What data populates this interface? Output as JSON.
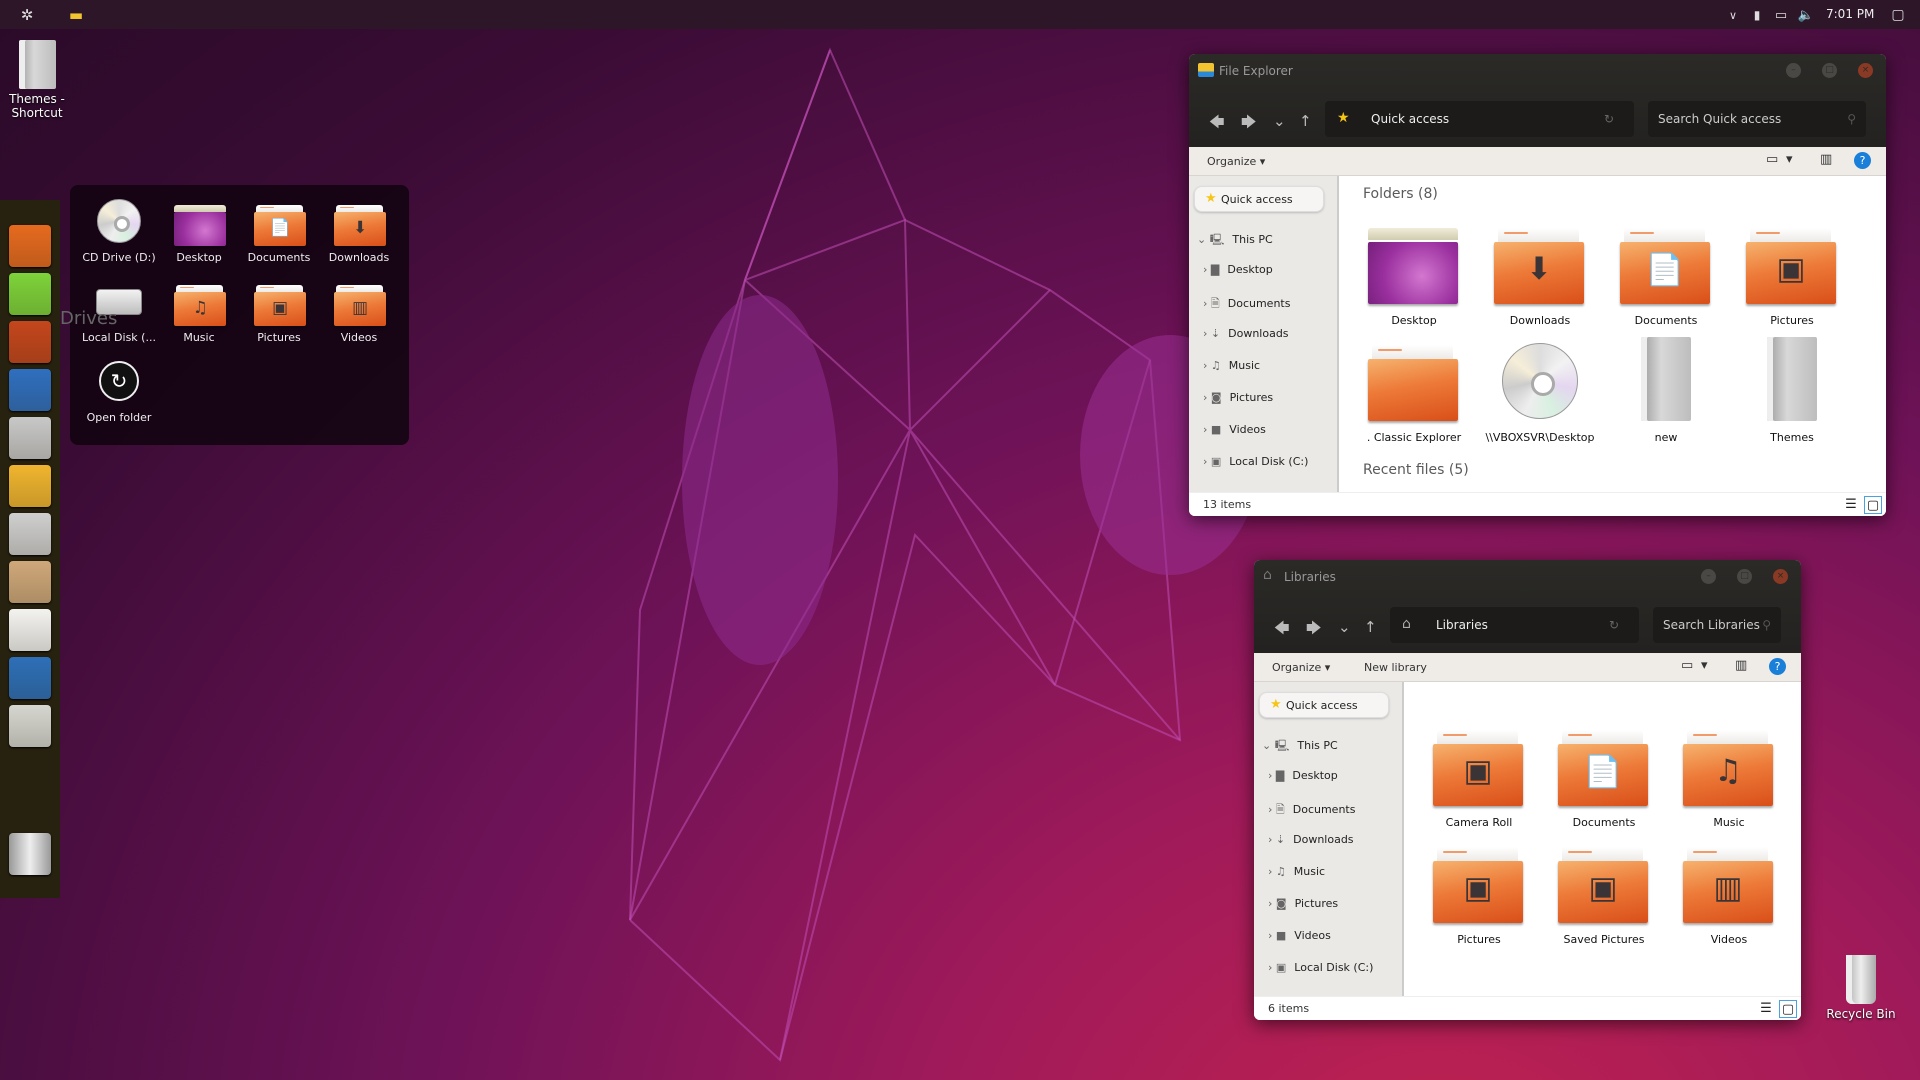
{
  "taskbar": {
    "clock": "7:01 PM",
    "tray": [
      "chevron-up-icon",
      "battery-icon",
      "network-icon",
      "volume-icon"
    ],
    "notifications_icon": "action-center-icon"
  },
  "desktop_icons": [
    {
      "label": "Themes - Shortcut",
      "icon": "grey"
    },
    {
      "label": "Recycle Bin",
      "icon": "recycle-bin"
    }
  ],
  "launcher": {
    "items": [
      {
        "name": "firefox",
        "color": "#e66a1f"
      },
      {
        "name": "ubuntu-software",
        "color": "#7ed33a"
      },
      {
        "name": "ubuntu-home",
        "color": "#c4461c"
      },
      {
        "name": "desktop-editor",
        "color": "#2f6fbf"
      },
      {
        "name": "system-settings",
        "color": "#c8c8c8"
      },
      {
        "name": "contacts",
        "color": "#f0b52f"
      },
      {
        "name": "user-accounts",
        "color": "#cfcfcf"
      },
      {
        "name": "paint",
        "color": "#cfa87a"
      },
      {
        "name": "text-editor",
        "color": "#f3f3f0"
      },
      {
        "name": "writer",
        "color": "#2d6fb8"
      },
      {
        "name": "calculator",
        "color": "#d6d6d0"
      }
    ],
    "trash": "trash"
  },
  "drives_panel": {
    "tooltip": "Drives",
    "items": [
      {
        "label": "CD Drive (D:)",
        "icon": "cd"
      },
      {
        "label": "Desktop",
        "icon": "desk"
      },
      {
        "label": "Documents",
        "icon": "folder",
        "emblem": "📄"
      },
      {
        "label": "Downloads",
        "icon": "folder",
        "emblem": "⬇"
      },
      {
        "label": "Local Disk (...",
        "icon": "hdd"
      },
      {
        "label": "Music",
        "icon": "folder",
        "emblem": "♫"
      },
      {
        "label": "Pictures",
        "icon": "folder",
        "emblem": "▣"
      },
      {
        "label": "Videos",
        "icon": "folder",
        "emblem": "▥"
      },
      {
        "label": "Open folder",
        "icon": "open"
      }
    ]
  },
  "explorer": {
    "title": "File Explorer",
    "address": "Quick access",
    "search_placeholder": "Search Quick access",
    "commands": [
      "Organize ▾"
    ],
    "nav": {
      "quick_access": "Quick access",
      "this_pc": "This PC",
      "items": [
        "Desktop",
        "Documents",
        "Downloads",
        "Music",
        "Pictures",
        "Videos",
        "Local Disk (C:)"
      ]
    },
    "sections": [
      "Folders (8)",
      "Recent files (5)"
    ],
    "items": [
      {
        "label": "Desktop",
        "icon": "desk"
      },
      {
        "label": "Downloads",
        "icon": "folder",
        "emblem": "⬇"
      },
      {
        "label": "Documents",
        "icon": "folder",
        "emblem": "📄"
      },
      {
        "label": "Pictures",
        "icon": "folder",
        "emblem": "▣"
      },
      {
        "label": ". Classic Explorer",
        "icon": "folder"
      },
      {
        "label": "\\\\VBOXSVR\\Desktop",
        "icon": "cd"
      },
      {
        "label": "new",
        "icon": "grey"
      },
      {
        "label": "Themes",
        "icon": "grey"
      }
    ],
    "status": "13 items"
  },
  "libraries": {
    "title": "Libraries",
    "address": "Libraries",
    "search_placeholder": "Search Libraries",
    "commands": [
      "Organize ▾",
      "New library"
    ],
    "nav": {
      "quick_access": "Quick access",
      "this_pc": "This PC",
      "items": [
        "Desktop",
        "Documents",
        "Downloads",
        "Music",
        "Pictures",
        "Videos",
        "Local Disk (C:)"
      ]
    },
    "sections": [],
    "items": [
      {
        "label": "Camera Roll",
        "icon": "folder",
        "emblem": "▣"
      },
      {
        "label": "Documents",
        "icon": "folder",
        "emblem": "📄"
      },
      {
        "label": "Music",
        "icon": "folder",
        "emblem": "♫"
      },
      {
        "label": "Pictures",
        "icon": "folder",
        "emblem": "▣"
      },
      {
        "label": "Saved Pictures",
        "icon": "folder",
        "emblem": "▣"
      },
      {
        "label": "Videos",
        "icon": "folder",
        "emblem": "▥"
      }
    ],
    "status": "6 items"
  },
  "colors": {
    "accent": "#e95420",
    "help": "#1a7fd8",
    "taskbar": "#2c1628",
    "launcher": "#27210f"
  }
}
